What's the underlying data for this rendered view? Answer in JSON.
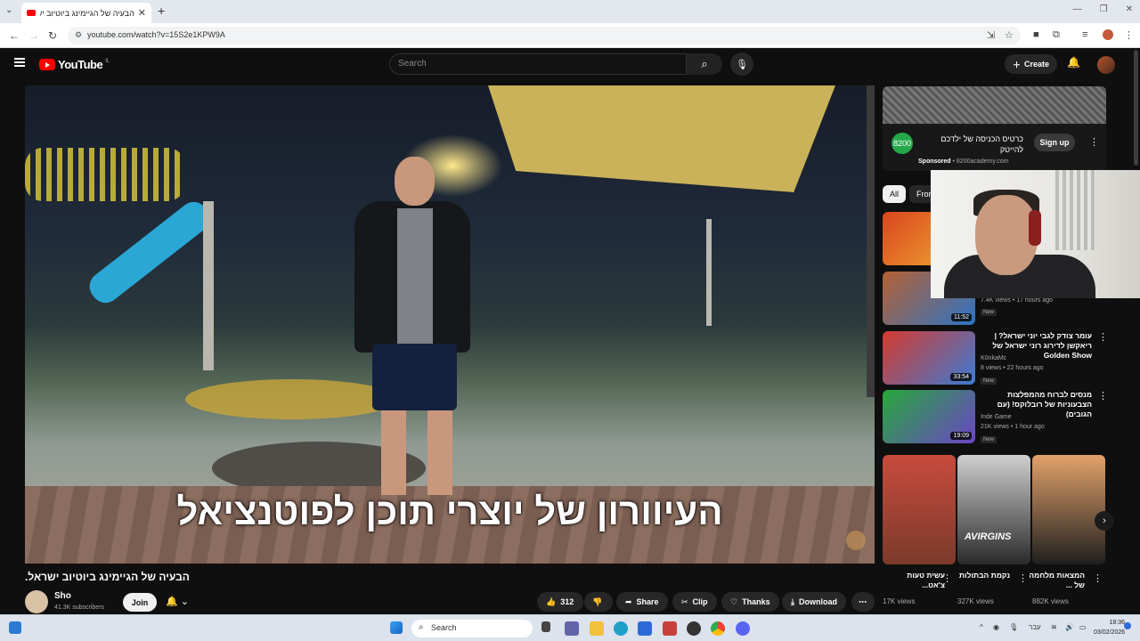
{
  "browser": {
    "tab_title": "הבעיה של הגיימינג ביוטיוב ישראל",
    "url": "youtube.com/watch?v=15S2e1KPW9A"
  },
  "header": {
    "logo_text": "YouTube",
    "region": "IL",
    "search_placeholder": "Search",
    "create_label": "Create"
  },
  "video": {
    "subtitle": "העיוורון של יוצרי תוכן לפוטנציאל",
    "title": "הבעיה של הגיימינג ביוטיוב ישראל.",
    "channel": "Sho",
    "subscribers": "41.3K subscribers",
    "join_label": "Join",
    "likes": "312",
    "share_label": "Share",
    "clip_label": "Clip",
    "thanks_label": "Thanks",
    "download_label": "Download"
  },
  "ad": {
    "title": "כרטיס הכניסה של ילדכם להייטק",
    "sponsored": "Sponsored",
    "domain": "8200academy.com",
    "cta": "Sign up"
  },
  "chips": [
    "All",
    "From"
  ],
  "recommendations": [
    {
      "title": "",
      "channel": "",
      "meta": "",
      "duration": "",
      "badge": "",
      "colors": [
        "#d9451f",
        "#f2b033"
      ]
    },
    {
      "title": "",
      "channel": "",
      "meta": "7.4K views • 17 hours ago",
      "duration": "11:52",
      "badge": "New",
      "colors": [
        "#b56134",
        "#2d74c4"
      ]
    },
    {
      "title": "עומר צודק לגבי יוני ישראל? | ריאקשן לדירוג רוני ישראל של Golden Show",
      "channel": "K0nkaMc",
      "meta": "8 views • 22 hours ago",
      "duration": "33:54",
      "badge": "New",
      "colors": [
        "#d63a2f",
        "#3b7bd3"
      ]
    },
    {
      "title": "מנסים לברוח מהמפלצות הצבעוניות של רובלוקס! (עם הגובים)",
      "channel": "Inde Game",
      "meta": "21K views • 1 hour ago",
      "duration": "19:09",
      "badge": "New",
      "colors": [
        "#27a83b",
        "#6b45c7"
      ]
    }
  ],
  "shorts": [
    {
      "title": "עשית טעות צ'אט...",
      "views": "17K views",
      "colors": [
        "#c94b3e",
        "#7a3a2a"
      ]
    },
    {
      "title": "נקמת הבתולות",
      "views": "327K views",
      "colors": [
        "#cfcfcf",
        "#2a2a2a"
      ]
    },
    {
      "title": "המצאות מלחמה של ...",
      "views": "882K views",
      "colors": [
        "#e3a26b",
        "#1f1f1f"
      ]
    }
  ],
  "short_overlay": "AVIRGINS",
  "taskbar": {
    "search_label": "Search",
    "lang": "עבר",
    "time": "18:36",
    "date": "03/02/2026"
  }
}
